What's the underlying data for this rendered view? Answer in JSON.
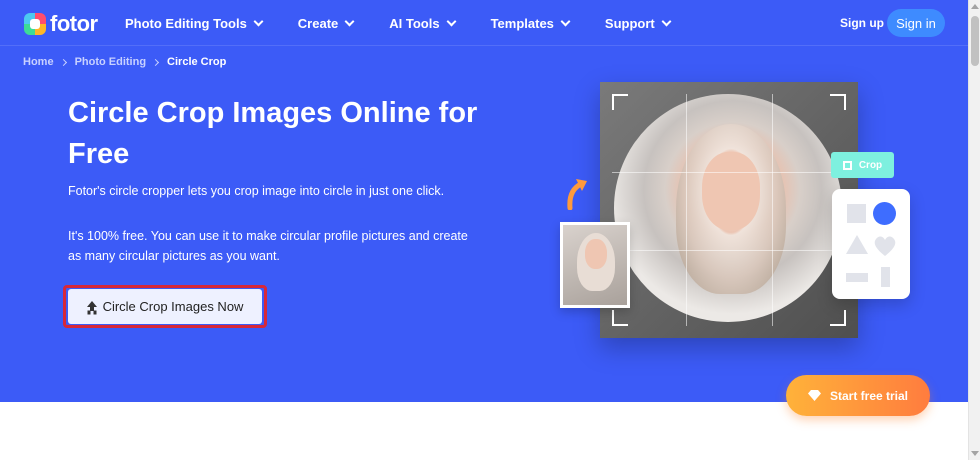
{
  "nav": {
    "logo_text": "fotor",
    "menu": [
      {
        "label": "Photo Editing Tools"
      },
      {
        "label": "Create"
      },
      {
        "label": "AI Tools"
      },
      {
        "label": "Templates"
      },
      {
        "label": "Support"
      }
    ],
    "signup_label": "Sign up",
    "signin_label": "Sign in"
  },
  "breadcrumb": {
    "items": [
      "Home",
      "Photo Editing"
    ],
    "current": "Circle Crop"
  },
  "hero": {
    "title": "Circle Crop Images Online for Free",
    "desc1": "Fotor's circle cropper lets you crop image into circle in just one click.",
    "desc2": "It's 100% free. You can use it to make circular profile pictures and create as many circular pictures as you want.",
    "cta_label": "Circle Crop Images Now",
    "crop_tag": "Crop",
    "trial_label": "Start free trial"
  },
  "colors": {
    "hero_bg": "#3c5bf7",
    "signin_bg": "#3e8bff",
    "cta_highlight": "#d62839",
    "crop_tag_bg": "#7ef0df",
    "trial_gradient_start": "#ffb23a",
    "trial_gradient_end": "#ff7c3e"
  },
  "icons": [
    "fotor-logo-icon",
    "chevron-down-icon",
    "upload-icon",
    "crop-icon",
    "diamond-icon",
    "curved-arrow-icon"
  ]
}
